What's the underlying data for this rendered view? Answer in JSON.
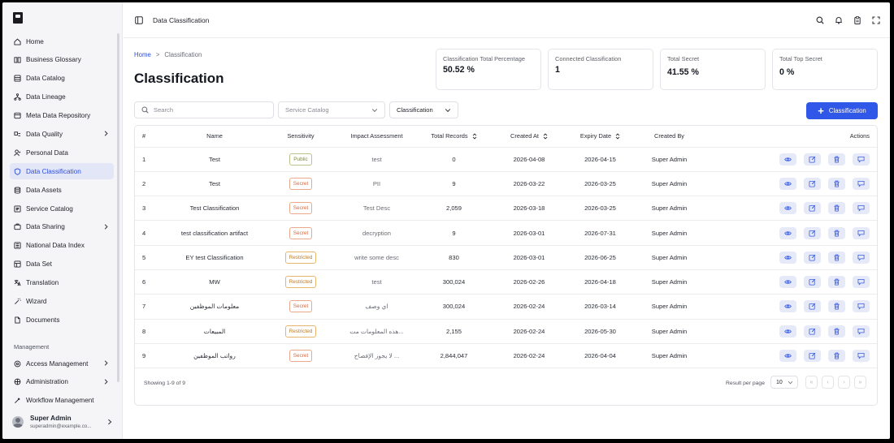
{
  "sidebar": {
    "items": [
      {
        "label": "Home",
        "icon": "home-icon"
      },
      {
        "label": "Business Glossary",
        "icon": "book-icon"
      },
      {
        "label": "Data Catalog",
        "icon": "catalog-icon"
      },
      {
        "label": "Data Lineage",
        "icon": "lineage-icon"
      },
      {
        "label": "Meta Data Repository",
        "icon": "repository-icon"
      },
      {
        "label": "Data Quality",
        "icon": "quality-icon"
      },
      {
        "label": "Personal Data",
        "icon": "person-icon"
      },
      {
        "label": "Data Classification",
        "icon": "shield-icon"
      },
      {
        "label": "Data Assets",
        "icon": "database-icon"
      },
      {
        "label": "Service Catalog",
        "icon": "service-icon"
      },
      {
        "label": "Data Sharing",
        "icon": "share-icon"
      },
      {
        "label": "National Data Index",
        "icon": "index-icon"
      },
      {
        "label": "Data Set",
        "icon": "dataset-icon"
      },
      {
        "label": "Translation",
        "icon": "translation-icon"
      },
      {
        "label": "Wizard",
        "icon": "wizard-icon"
      },
      {
        "label": "Documents",
        "icon": "document-icon"
      }
    ],
    "section_label": "Management",
    "management_items": [
      {
        "label": "Access Management",
        "icon": "access-icon"
      },
      {
        "label": "Administration",
        "icon": "admin-icon"
      },
      {
        "label": "Workflow Management",
        "icon": "workflow-icon"
      }
    ],
    "user": {
      "name": "Super Admin",
      "email": "superadmin@example.co..."
    }
  },
  "header": {
    "title": "Data Classification"
  },
  "breadcrumb": {
    "home": "Home",
    "separator": ">",
    "current": "Classification"
  },
  "page": {
    "title": "Classification"
  },
  "stats": [
    {
      "label": "Classification Total Percentage",
      "value": "50.52 %"
    },
    {
      "label": "Connected Classification",
      "value": "1"
    },
    {
      "label": "Total Secret",
      "value": "41.55 %"
    },
    {
      "label": "Total Top Secret",
      "value": "0 %"
    }
  ],
  "filters": {
    "search_placeholder": "Search",
    "service_catalog_placeholder": "Service Catalog",
    "classification_label": "Classification"
  },
  "add_button": {
    "label": "Classification"
  },
  "table": {
    "headers": {
      "index": "#",
      "name": "Name",
      "sensitivity": "Sensitivity",
      "impact": "Impact Assessment",
      "records": "Total Records",
      "created": "Created At",
      "expiry": "Expiry Date",
      "created_by": "Created By",
      "actions": "Actions"
    },
    "rows": [
      {
        "index": "1",
        "name": "Test",
        "sensitivity": "Public",
        "impact": "test",
        "records": "0",
        "created": "2026-04-08",
        "expiry": "2026-04-15",
        "created_by": "Super Admin"
      },
      {
        "index": "2",
        "name": "Test",
        "sensitivity": "Secret",
        "impact": "PII",
        "records": "9",
        "created": "2026-03-22",
        "expiry": "2026-03-25",
        "created_by": "Super Admin"
      },
      {
        "index": "3",
        "name": "Test Classification",
        "sensitivity": "Secret",
        "impact": "Test Desc",
        "records": "2,059",
        "created": "2026-03-18",
        "expiry": "2026-03-25",
        "created_by": "Super Admin"
      },
      {
        "index": "4",
        "name": "test classification artifact",
        "sensitivity": "Secret",
        "impact": "decryption",
        "records": "9",
        "created": "2026-03-01",
        "expiry": "2026-07-31",
        "created_by": "Super Admin"
      },
      {
        "index": "5",
        "name": "EY test Classification",
        "sensitivity": "Restricted",
        "impact": "write some desc",
        "records": "830",
        "created": "2026-03-01",
        "expiry": "2026-06-25",
        "created_by": "Super Admin"
      },
      {
        "index": "6",
        "name": "MW",
        "sensitivity": "Restricted",
        "impact": "test",
        "records": "300,024",
        "created": "2026-02-26",
        "expiry": "2026-04-18",
        "created_by": "Super Admin"
      },
      {
        "index": "7",
        "name": "معلومات الموظفين",
        "sensitivity": "Secret",
        "impact": "اي وصف",
        "records": "300,024",
        "created": "2026-02-24",
        "expiry": "2026-03-14",
        "created_by": "Super Admin"
      },
      {
        "index": "8",
        "name": "المبيعات",
        "sensitivity": "Restricted",
        "impact": "هذه المعلومات مت...",
        "records": "2,155",
        "created": "2026-02-24",
        "expiry": "2026-05-30",
        "created_by": "Super Admin"
      },
      {
        "index": "9",
        "name": "رواتب الموظفين",
        "sensitivity": "Secret",
        "impact": "لا يجوز الإفصاح ...",
        "records": "2,844,047",
        "created": "2026-02-24",
        "expiry": "2026-04-04",
        "created_by": "Super Admin"
      }
    ]
  },
  "footer": {
    "showing": "Showing 1-9 of 9",
    "rpp_label": "Result per page",
    "rpp_value": "10",
    "pager": [
      "«",
      "‹",
      "›",
      "»"
    ]
  },
  "colors": {
    "accent": "#2f57e8",
    "active_bg": "#e2e6f7",
    "action_bg": "#e5e9f8"
  }
}
